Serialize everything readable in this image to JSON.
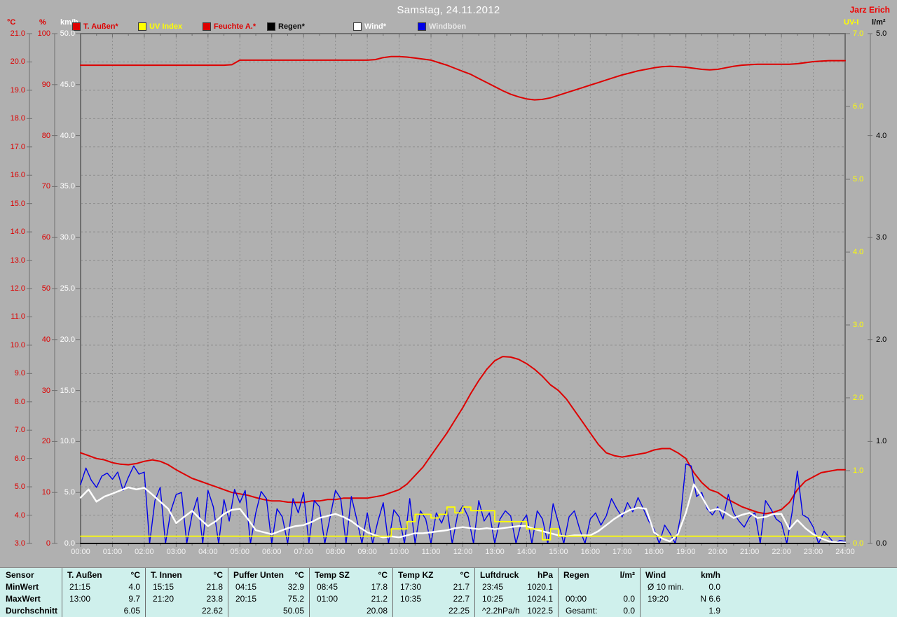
{
  "window": {
    "title": "Samstag, 24.11.2012",
    "author": "Jarz Erich"
  },
  "legend": [
    {
      "label": "T. Außen*",
      "swatch": "#dd0000",
      "text_color": "#dd0000"
    },
    {
      "label": "UV Index",
      "swatch": "#ffff00",
      "text_color": "#ffff00"
    },
    {
      "label": "Feuchte A.*",
      "swatch": "#dd0000",
      "text_color": "#dd0000"
    },
    {
      "label": "Regen*",
      "swatch": "#000000",
      "text_color": "#0a0a0a"
    },
    {
      "label": "Wind*",
      "swatch": "#ffffff",
      "text_color": "#ffffff"
    },
    {
      "label": "Windböen",
      "swatch": "#0000e8",
      "text_color": "#e8e8e8"
    }
  ],
  "axes": {
    "left": [
      {
        "name": "temperature",
        "unit": "°C",
        "color": "#dd0000",
        "labels": [
          "21.0",
          "20.0",
          "19.0",
          "18.0",
          "17.0",
          "16.0",
          "15.0",
          "14.0",
          "13.0",
          "12.0",
          "11.0",
          "10.0",
          "9.0",
          "8.0",
          "7.0",
          "6.0",
          "5.0",
          "4.0",
          "3.0"
        ]
      },
      {
        "name": "humidity",
        "unit": "%",
        "color": "#dd0000",
        "labels": [
          "100",
          "90",
          "80",
          "70",
          "60",
          "50",
          "40",
          "30",
          "20",
          "10",
          "0"
        ]
      },
      {
        "name": "wind",
        "unit": "km/h",
        "color": "#ffffff",
        "labels": [
          "50.0",
          "45.0",
          "40.0",
          "35.0",
          "30.0",
          "25.0",
          "20.0",
          "15.0",
          "10.0",
          "5.0",
          "0.0"
        ]
      }
    ],
    "right": [
      {
        "name": "uv",
        "unit": "UV-I",
        "color": "#ffff00",
        "labels": [
          "7.0",
          "6.0",
          "5.0",
          "4.0",
          "3.0",
          "2.0",
          "1.0",
          "0.0"
        ]
      },
      {
        "name": "rain",
        "unit": "l/m²",
        "color": "#000000",
        "labels": [
          "5.0",
          "4.0",
          "3.0",
          "2.0",
          "1.0",
          "0.0"
        ]
      }
    ],
    "x": {
      "labels": [
        "00:00",
        "01:00",
        "02:00",
        "03:00",
        "04:00",
        "05:00",
        "06:00",
        "07:00",
        "08:00",
        "09:00",
        "10:00",
        "11:00",
        "12:00",
        "13:00",
        "14:00",
        "15:00",
        "16:00",
        "17:00",
        "18:00",
        "19:00",
        "20:00",
        "21:00",
        "22:00",
        "23:00",
        "24:00"
      ]
    }
  },
  "chart_data": {
    "type": "line",
    "title": "Samstag, 24.11.2012",
    "x_range_hours": [
      0,
      24
    ],
    "grid": "dashed, vertical per hour, horizontal per 1 °C step",
    "series": [
      {
        "name": "Feuchte A.",
        "unit": "%",
        "color": "#dd0000",
        "width": 2,
        "axis_range": [
          0,
          100
        ],
        "step_min": 15,
        "values": [
          93.8,
          93.8,
          93.8,
          93.8,
          93.8,
          93.8,
          93.8,
          93.8,
          93.8,
          93.8,
          93.8,
          93.8,
          93.8,
          93.8,
          93.8,
          93.8,
          93.8,
          93.8,
          93.8,
          93.9,
          94.8,
          94.8,
          94.8,
          94.8,
          94.8,
          94.8,
          94.8,
          94.8,
          94.8,
          94.8,
          94.8,
          94.8,
          94.8,
          94.8,
          94.8,
          94.8,
          94.8,
          94.9,
          95.3,
          95.5,
          95.5,
          95.4,
          95.2,
          95.0,
          94.8,
          94.3,
          93.8,
          93.2,
          92.6,
          92.0,
          91.2,
          90.4,
          89.6,
          88.8,
          88.1,
          87.6,
          87.2,
          87.0,
          87.1,
          87.4,
          87.9,
          88.4,
          88.9,
          89.4,
          89.9,
          90.4,
          90.9,
          91.4,
          91.9,
          92.3,
          92.7,
          93.0,
          93.3,
          93.5,
          93.6,
          93.5,
          93.4,
          93.2,
          93.0,
          92.9,
          93.0,
          93.3,
          93.6,
          93.8,
          93.9,
          94.0,
          94.0,
          94.0,
          94.0,
          94.0,
          94.1,
          94.3,
          94.5,
          94.6,
          94.7,
          94.7,
          94.7
        ]
      },
      {
        "name": "T. Außen",
        "unit": "°C",
        "color": "#dd0000",
        "width": 2,
        "axis_range": [
          3,
          21
        ],
        "step_min": 15,
        "values": [
          6.2,
          6.1,
          6.0,
          5.95,
          5.85,
          5.8,
          5.78,
          5.82,
          5.9,
          5.95,
          5.9,
          5.78,
          5.6,
          5.45,
          5.3,
          5.2,
          5.1,
          5.0,
          4.9,
          4.8,
          4.75,
          4.7,
          4.62,
          4.55,
          4.5,
          4.5,
          4.46,
          4.45,
          4.45,
          4.5,
          4.5,
          4.55,
          4.55,
          4.6,
          4.6,
          4.6,
          4.6,
          4.65,
          4.7,
          4.8,
          4.9,
          5.1,
          5.4,
          5.7,
          6.1,
          6.5,
          6.9,
          7.35,
          7.8,
          8.3,
          8.75,
          9.15,
          9.45,
          9.6,
          9.58,
          9.5,
          9.35,
          9.15,
          8.9,
          8.6,
          8.4,
          8.1,
          7.7,
          7.3,
          6.9,
          6.5,
          6.2,
          6.1,
          6.05,
          6.1,
          6.15,
          6.2,
          6.3,
          6.35,
          6.35,
          6.2,
          6.0,
          5.5,
          5.15,
          4.9,
          4.8,
          4.6,
          4.45,
          4.3,
          4.2,
          4.1,
          4.05,
          4.1,
          4.2,
          4.45,
          4.9,
          5.2,
          5.35,
          5.5,
          5.55,
          5.6,
          5.6
        ]
      },
      {
        "name": "Windböen",
        "unit": "km/h",
        "color": "#0000e8",
        "width": 1.4,
        "axis_range": [
          0,
          50
        ],
        "step_min": 10,
        "values": [
          5.8,
          7.4,
          6.2,
          5.5,
          6.6,
          6.9,
          6.3,
          7.0,
          5.2,
          6.5,
          7.6,
          6.8,
          7.0,
          0,
          4.2,
          5.5,
          0,
          3.2,
          4.8,
          5.0,
          0,
          2.8,
          4.5,
          0,
          5.2,
          3.6,
          0,
          4.3,
          2.2,
          5.3,
          4.0,
          5.2,
          0,
          3.0,
          5.1,
          4.4,
          0,
          3.4,
          2.6,
          0,
          4.4,
          3.0,
          5.0,
          0,
          4.2,
          3.6,
          0,
          2.6,
          5.2,
          4.4,
          0,
          4.6,
          2.4,
          0,
          3.0,
          0,
          2.2,
          4.0,
          0,
          3.3,
          2.6,
          0,
          4.4,
          0,
          3.2,
          2.4,
          0,
          3.0,
          2.0,
          3.4,
          0,
          2.8,
          3.7,
          2.6,
          0,
          4.2,
          2.2,
          3.0,
          0,
          2.4,
          3.2,
          2.7,
          0,
          2.0,
          2.8,
          0,
          3.2,
          2.4,
          0,
          3.9,
          2.0,
          0,
          2.6,
          3.2,
          1.4,
          0,
          2.4,
          3.0,
          1.8,
          2.7,
          4.4,
          3.4,
          2.6,
          4.0,
          3.1,
          4.5,
          3.4,
          2.2,
          1.4,
          0,
          1.8,
          1.0,
          0,
          2.6,
          7.8,
          7.6,
          4.6,
          5.0,
          3.4,
          2.8,
          3.6,
          2.4,
          4.8,
          3.0,
          2.2,
          1.6,
          2.6,
          3.0,
          0,
          4.2,
          3.4,
          2.4,
          2.0,
          0,
          3.0,
          7.1,
          2.8,
          2.5,
          1.6,
          0,
          1.2,
          0.6,
          0,
          0.3,
          0.2
        ]
      },
      {
        "name": "Wind",
        "unit": "km/h",
        "color": "#ffffff",
        "width": 2.4,
        "axis_range": [
          0,
          50
        ],
        "step_min": 15,
        "values": [
          4.5,
          5.3,
          4.1,
          4.6,
          4.9,
          5.2,
          5.5,
          5.3,
          5.45,
          4.8,
          4.1,
          3.4,
          2.0,
          2.6,
          3.2,
          2.4,
          1.7,
          2.2,
          2.9,
          3.3,
          3.4,
          2.4,
          1.3,
          1.1,
          0.9,
          1.2,
          1.5,
          1.7,
          1.8,
          2.1,
          2.5,
          2.7,
          2.9,
          2.6,
          2.2,
          1.6,
          1.1,
          0.8,
          0.6,
          0.7,
          0.6,
          0.8,
          1.0,
          1.0,
          1.1,
          1.2,
          1.3,
          1.5,
          1.6,
          1.5,
          1.4,
          1.5,
          1.4,
          1.5,
          1.6,
          1.7,
          1.7,
          1.4,
          1.2,
          1.0,
          0.8,
          0.7,
          0.8,
          0.8,
          0.8,
          1.2,
          1.8,
          2.4,
          2.9,
          3.3,
          3.5,
          3.4,
          1.1,
          0.5,
          0.2,
          0.9,
          3.0,
          5.8,
          4.6,
          3.2,
          3.4,
          3.0,
          2.5,
          2.8,
          3.0,
          2.5,
          2.6,
          2.9,
          2.9,
          1.4,
          2.3,
          1.5,
          0.9,
          0.5,
          0.2,
          0.1,
          0.1
        ]
      },
      {
        "name": "UV Index",
        "unit": "UV-I",
        "color": "#ffff00",
        "width": 1.8,
        "axis_range": [
          0,
          7
        ],
        "step_min": 15,
        "render": "step",
        "values": [
          0.1,
          0.1,
          0.1,
          0.1,
          0.1,
          0.1,
          0.1,
          0.1,
          0.1,
          0.1,
          0.1,
          0.1,
          0.1,
          0.1,
          0.1,
          0.1,
          0.1,
          0.1,
          0.1,
          0.1,
          0.1,
          0.1,
          0.1,
          0.1,
          0.1,
          0.1,
          0.1,
          0.1,
          0.1,
          0.1,
          0.1,
          0.1,
          0.1,
          0.1,
          0.1,
          0.1,
          0.1,
          0.1,
          0.1,
          0.2,
          0.2,
          0.3,
          0.4,
          0.4,
          0.35,
          0.4,
          0.5,
          0.42,
          0.5,
          0.45,
          0.45,
          0.45,
          0.3,
          0.3,
          0.3,
          0.3,
          0.2,
          0.2,
          0.05,
          0.2,
          0.1,
          0.1,
          0.1,
          0.1,
          0.1,
          0.1,
          0.1,
          0.1,
          0.1,
          0.1,
          0.1,
          0.1,
          0.1,
          0.1,
          0.1,
          0.1,
          0.1,
          0.1,
          0.1,
          0.1,
          0.1,
          0.1,
          0.1,
          0.1,
          0.1,
          0.1,
          0.1,
          0.1,
          0.1,
          0.1,
          0.1,
          0.1,
          0.1,
          0.1,
          0.1,
          0.1,
          0.1
        ]
      },
      {
        "name": "Regen",
        "unit": "l/m²",
        "color": "#000000",
        "width": 1.8,
        "axis_range": [
          0,
          5
        ],
        "step_min": 60,
        "values": [
          0,
          0,
          0,
          0,
          0,
          0,
          0,
          0,
          0,
          0,
          0,
          0,
          0,
          0,
          0,
          0,
          0,
          0,
          0,
          0,
          0,
          0,
          0,
          0,
          0
        ]
      }
    ]
  },
  "table": {
    "row_labels": [
      "Sensor",
      "MinWert",
      "MaxWert",
      "Durchschnitt"
    ],
    "columns": [
      {
        "name": "T. Außen",
        "unit": "°C",
        "min": [
          "21:15",
          "4.0"
        ],
        "max": [
          "13:00",
          "9.7"
        ],
        "avg": [
          "",
          "6.05"
        ]
      },
      {
        "name": "T. Innen",
        "unit": "°C",
        "min": [
          "15:15",
          "21.8"
        ],
        "max": [
          "21:20",
          "23.8"
        ],
        "avg": [
          "",
          "22.62"
        ]
      },
      {
        "name": "Puffer Unten",
        "unit": "°C",
        "min": [
          "04:15",
          "32.9"
        ],
        "max": [
          "20:15",
          "75.2"
        ],
        "avg": [
          "",
          "50.05"
        ]
      },
      {
        "name": "Temp SZ",
        "unit": "°C",
        "min": [
          "08:45",
          "17.8"
        ],
        "max": [
          "01:00",
          "21.2"
        ],
        "avg": [
          "",
          "20.08"
        ]
      },
      {
        "name": "Temp KZ",
        "unit": "°C",
        "min": [
          "17:30",
          "21.7"
        ],
        "max": [
          "10:35",
          "22.7"
        ],
        "avg": [
          "",
          "22.25"
        ]
      },
      {
        "name": "Luftdruck",
        "unit": "hPa",
        "min": [
          "23:45",
          "1020.1"
        ],
        "max": [
          "10:25",
          "1024.1"
        ],
        "avg": [
          "^2.2hPa/h",
          "1022.5"
        ]
      },
      {
        "name": "Regen",
        "unit": "l/m²",
        "min": [
          "",
          ""
        ],
        "max": [
          "00:00",
          "0.0"
        ],
        "avg": [
          "Gesamt:",
          "0.0"
        ]
      },
      {
        "name": "Wind",
        "unit": "km/h",
        "min": [
          "Ø 10 min.",
          "0.0"
        ],
        "max": [
          "19:20",
          "N 6.6"
        ],
        "avg": [
          "",
          "1.9"
        ]
      }
    ]
  },
  "colors": {
    "background": "#b0b0b0",
    "grid": "#8d8d8d",
    "axis": "#6f6f6f",
    "table_bg": "#cff0ec",
    "accent_red": "#dd0000",
    "accent_yellow": "#ffff00",
    "accent_blue": "#0000e8"
  }
}
